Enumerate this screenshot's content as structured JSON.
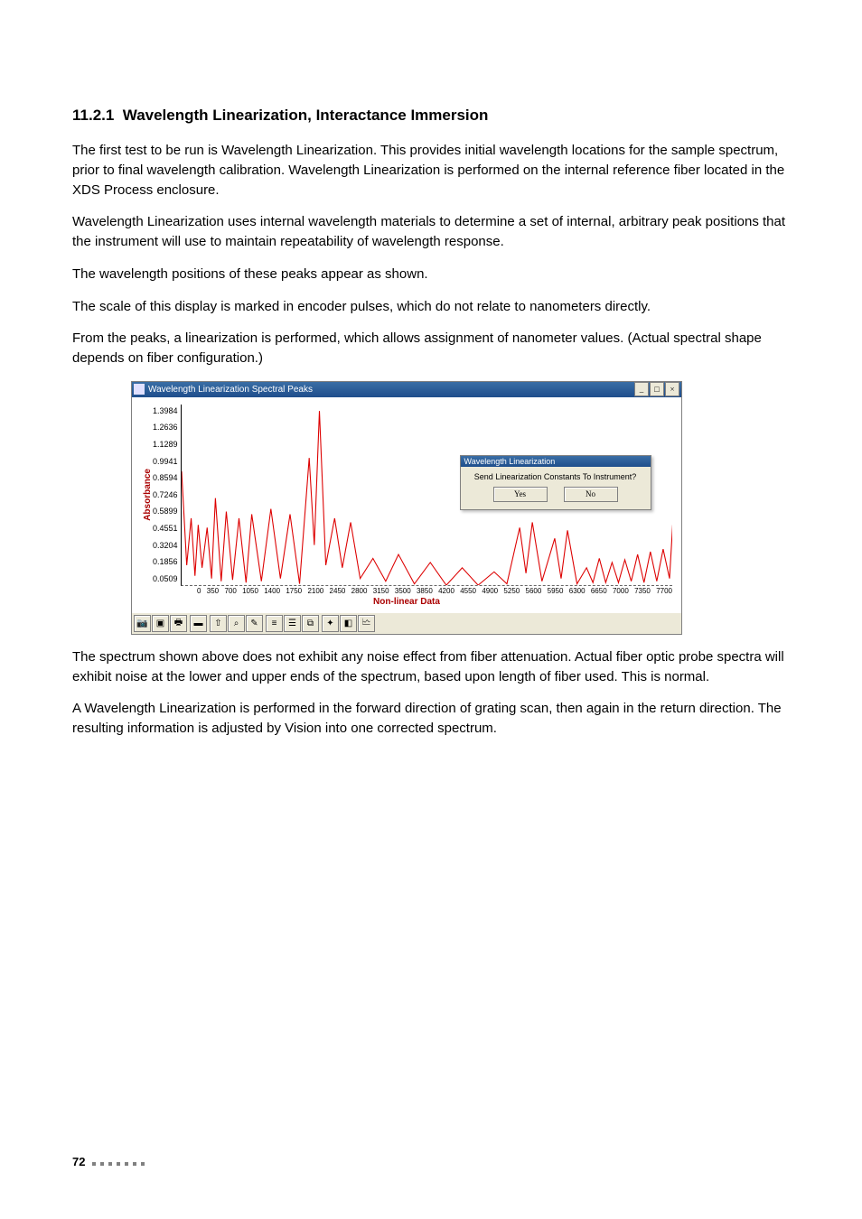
{
  "section": {
    "number": "11.2.1",
    "title": "Wavelength Linearization, Interactance Immersion"
  },
  "paragraphs": {
    "p1": "The first test to be run is Wavelength Linearization. This provides initial wavelength locations for the sample spectrum, prior to final wavelength calibration. Wavelength Linearization is performed on the internal reference fiber located in the XDS Process enclosure.",
    "p2": "Wavelength Linearization uses internal wavelength materials to determine a set of internal, arbitrary peak positions that the instrument will use to maintain repeatability of wavelength response.",
    "p3": "The wavelength positions of these peaks appear as shown.",
    "p4": "The scale of this display is marked in encoder pulses, which do not relate to nanometers directly.",
    "p5": "From the peaks, a linearization is performed, which allows assignment of nanometer values. (Actual spectral shape depends on fiber configuration.)",
    "p6": "The spectrum shown above does not exhibit any noise effect from fiber attenuation. Actual fiber optic probe spectra will exhibit noise at the lower and upper ends of the spectrum, based upon length of fiber used. This is normal.",
    "p7": "A Wavelength Linearization is performed in the forward direction of grating scan, then again in the return direction. The resulting information is adjusted by Vision into one corrected spectrum."
  },
  "chart_window": {
    "title": "Wavelength Linearization Spectral Peaks",
    "min_btn": "_",
    "max_btn": "□",
    "close_btn": "×"
  },
  "dialog": {
    "title": "Wavelength Linearization",
    "message": "Send Linearization Constants To Instrument?",
    "yes": "Yes",
    "no": "No"
  },
  "chart_data": {
    "type": "line",
    "title": "Wavelength Linearization Spectral Peaks",
    "ylabel": "Absorbance",
    "xlabel": "Non-linear Data",
    "yticks": [
      "1.3984",
      "1.2636",
      "1.1289",
      "0.9941",
      "0.8594",
      "0.7246",
      "0.5899",
      "0.4551",
      "0.3204",
      "0.1856",
      "0.0509"
    ],
    "xticks": [
      "0",
      "350",
      "700",
      "1050",
      "1400",
      "1750",
      "2100",
      "2450",
      "2800",
      "3150",
      "3500",
      "3850",
      "4200",
      "4550",
      "4900",
      "5250",
      "5600",
      "5950",
      "6300",
      "6650",
      "7000",
      "7350",
      "7700"
    ],
    "xlim": [
      0,
      7700
    ],
    "ylim": [
      0.0509,
      1.3984
    ],
    "series": [
      {
        "name": "spectrum",
        "color": "#d00",
        "points": [
          [
            0,
            0.9
          ],
          [
            80,
            0.2
          ],
          [
            150,
            0.55
          ],
          [
            210,
            0.12
          ],
          [
            260,
            0.5
          ],
          [
            320,
            0.18
          ],
          [
            400,
            0.48
          ],
          [
            470,
            0.1
          ],
          [
            530,
            0.7
          ],
          [
            620,
            0.08
          ],
          [
            700,
            0.6
          ],
          [
            800,
            0.09
          ],
          [
            900,
            0.55
          ],
          [
            1010,
            0.07
          ],
          [
            1100,
            0.58
          ],
          [
            1250,
            0.08
          ],
          [
            1400,
            0.62
          ],
          [
            1550,
            0.1
          ],
          [
            1700,
            0.58
          ],
          [
            1850,
            0.06
          ],
          [
            2000,
            1.0
          ],
          [
            2080,
            0.35
          ],
          [
            2160,
            1.35
          ],
          [
            2260,
            0.2
          ],
          [
            2400,
            0.55
          ],
          [
            2520,
            0.18
          ],
          [
            2650,
            0.52
          ],
          [
            2800,
            0.1
          ],
          [
            3000,
            0.25
          ],
          [
            3200,
            0.08
          ],
          [
            3400,
            0.28
          ],
          [
            3650,
            0.06
          ],
          [
            3900,
            0.22
          ],
          [
            4150,
            0.05
          ],
          [
            4400,
            0.18
          ],
          [
            4650,
            0.05
          ],
          [
            4900,
            0.15
          ],
          [
            5100,
            0.06
          ],
          [
            5300,
            0.48
          ],
          [
            5400,
            0.14
          ],
          [
            5500,
            0.52
          ],
          [
            5650,
            0.08
          ],
          [
            5850,
            0.4
          ],
          [
            5950,
            0.1
          ],
          [
            6050,
            0.46
          ],
          [
            6200,
            0.06
          ],
          [
            6350,
            0.18
          ],
          [
            6450,
            0.07
          ],
          [
            6550,
            0.25
          ],
          [
            6650,
            0.07
          ],
          [
            6750,
            0.22
          ],
          [
            6850,
            0.07
          ],
          [
            6950,
            0.24
          ],
          [
            7050,
            0.08
          ],
          [
            7150,
            0.28
          ],
          [
            7250,
            0.07
          ],
          [
            7350,
            0.3
          ],
          [
            7450,
            0.08
          ],
          [
            7550,
            0.32
          ],
          [
            7650,
            0.1
          ],
          [
            7700,
            0.5
          ]
        ]
      }
    ]
  },
  "toolbar_icons": [
    "camera-icon",
    "zoom-full-icon",
    "print-icon",
    "color-icon",
    "axis-up-icon",
    "axis-down-icon",
    "grid-icon",
    "cursor-icon",
    "list-icon",
    "tag-icon",
    "marker-icon",
    "region-icon",
    "properties-icon"
  ],
  "footer": {
    "page": "72"
  }
}
